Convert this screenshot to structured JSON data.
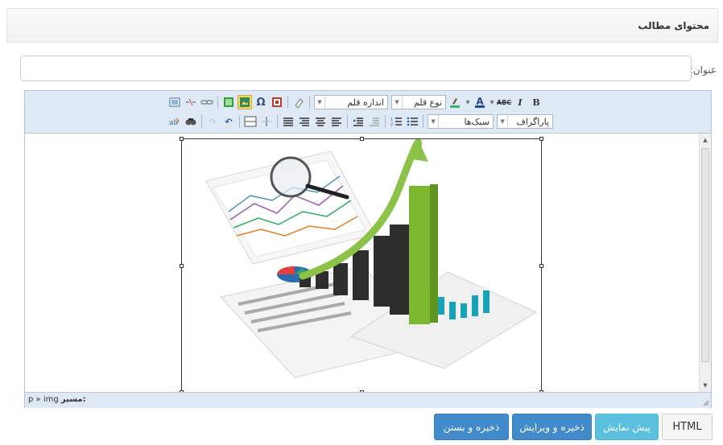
{
  "panel": {
    "title": "محتوای مطالب"
  },
  "form": {
    "title_label": "عنوان:",
    "title_value": ""
  },
  "toolbar": {
    "bold": "B",
    "italic": "I",
    "strike": "ABC",
    "font_family": "نوع قلم",
    "font_size": "اندازه قلم",
    "paragraph_format": "پاراگراف",
    "styles": "سبک‌ها",
    "row1_icons": [
      "bold-icon",
      "italic-icon",
      "strikethrough-icon",
      "font-color-icon",
      "highlight-color-icon",
      "font-family-select",
      "font-size-select",
      "eraser-icon",
      "insert-file-icon",
      "special-char-icon",
      "insert-image-icon",
      "insert-media-icon",
      "link-icon",
      "unlink-icon",
      "fullscreen-icon"
    ],
    "row2_icons": [
      "paragraph-select",
      "styles-select",
      "bullet-list-icon",
      "numbered-list-icon",
      "outdent-icon",
      "indent-icon",
      "align-justify-icon",
      "align-right-icon",
      "align-center-icon",
      "align-left-icon",
      "table-icon",
      "horizontal-rule-icon",
      "undo-icon",
      "redo-icon",
      "find-icon",
      "replace-icon"
    ]
  },
  "statusbar": {
    "path_label": "مسیر:",
    "path_value": "p » img"
  },
  "buttons": {
    "html": "HTML",
    "preview": "پیش نمایش",
    "save_edit": "ذخیره و ویرایش",
    "save_close": "ذخیره و بستن"
  },
  "colors": {
    "toolbar_bg": "#dfe9f6",
    "primary": "#428bca",
    "info": "#5bc0de"
  }
}
